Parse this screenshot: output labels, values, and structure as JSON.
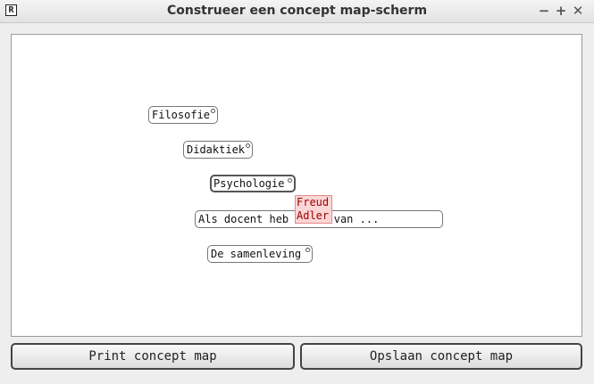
{
  "window": {
    "title": "Construeer een concept map-scherm",
    "icon": "app-logo-icon",
    "controls": {
      "minimize": "−",
      "maximize": "+",
      "close": "✕"
    }
  },
  "nodes": [
    {
      "label": "Filosofie"
    },
    {
      "label": "Didaktiek"
    },
    {
      "label": "Psychologie"
    },
    {
      "label": "Als docent heb        stand van ..."
    },
    {
      "label": "De samenleving"
    }
  ],
  "popup": {
    "lines": [
      "Freud",
      "Adler"
    ]
  },
  "buttons": {
    "print": "Print concept map",
    "save": "Opslaan concept map"
  }
}
